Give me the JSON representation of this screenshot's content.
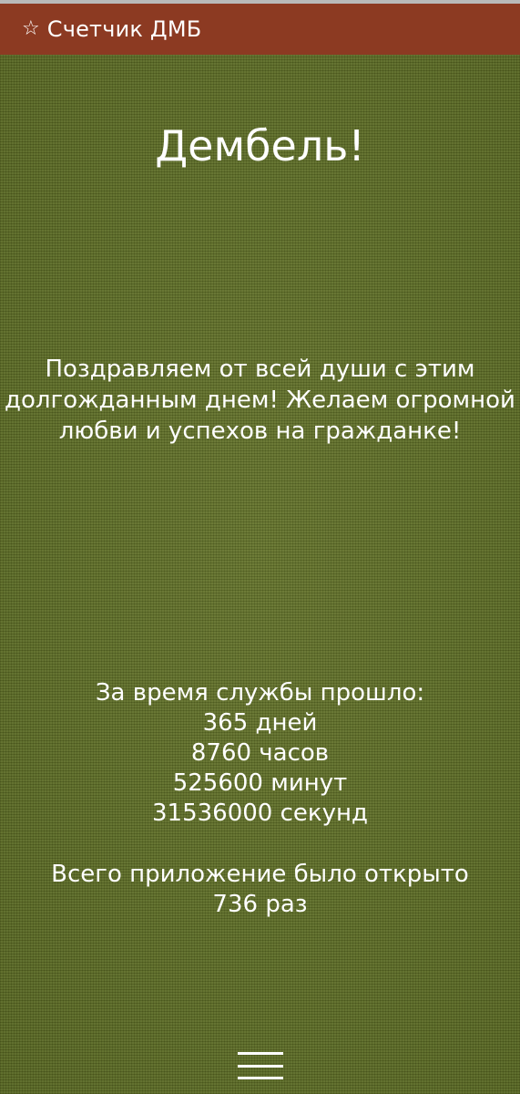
{
  "header": {
    "star_icon": "☆",
    "title": "Счетчик ДМБ",
    "color": "#8c3a22"
  },
  "main": {
    "headline": "Дембель!",
    "message": "Поздравляем от всей души с этим долгожданным днем! Желаем огромной любви и успехов на гражданке!",
    "stats": {
      "intro": "За время службы прошло:",
      "days": "365 дней",
      "hours": "8760 часов",
      "minutes": "525600 минут",
      "seconds": "31536000 секунд",
      "opened_label": "Всего приложение было открыто",
      "opened_count": "736 раз"
    }
  },
  "footer": {
    "menu_icon": "hamburger-menu-icon"
  }
}
